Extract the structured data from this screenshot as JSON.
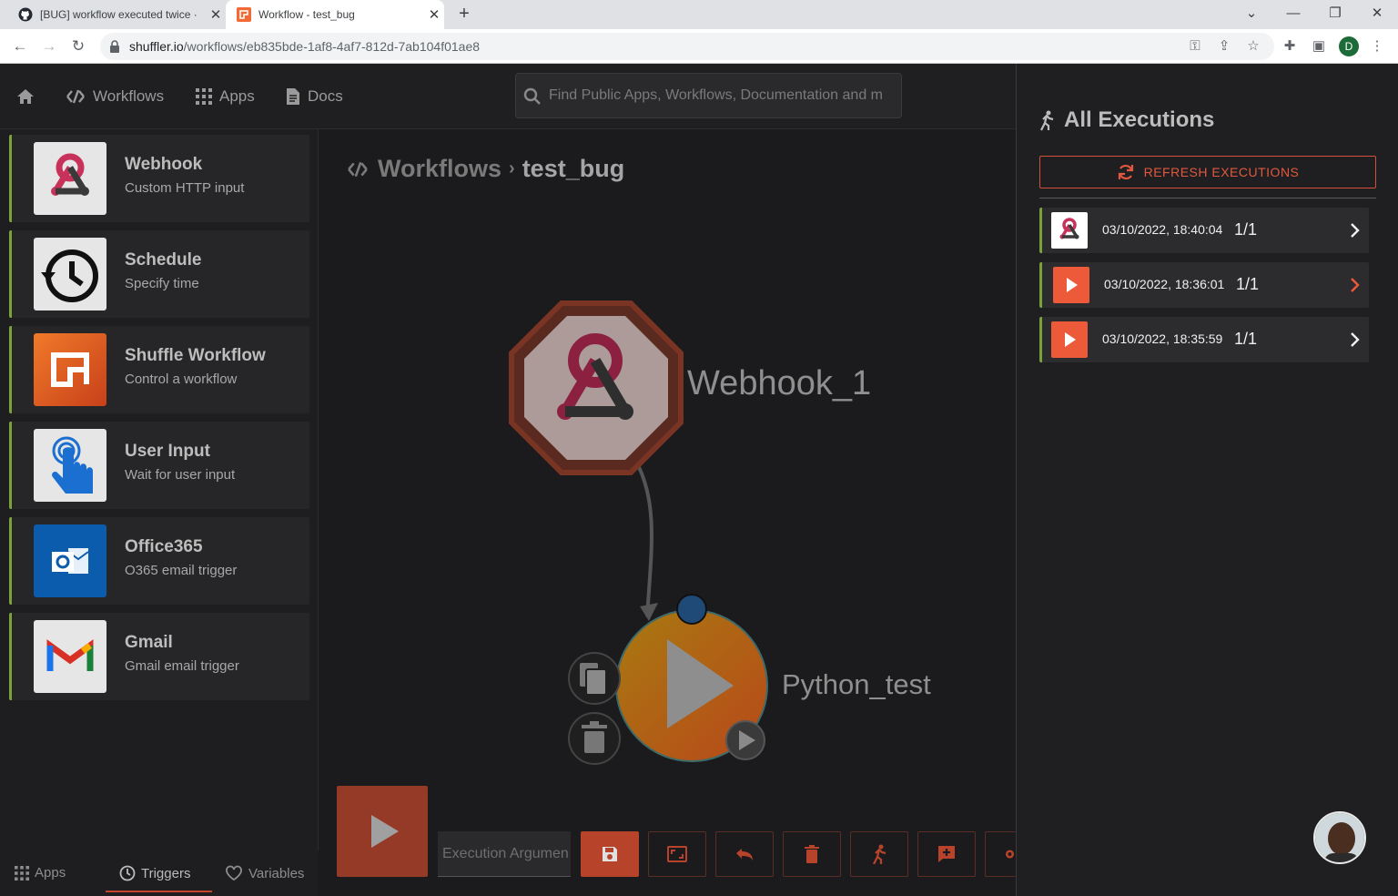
{
  "browser": {
    "tabs": [
      {
        "title": "[BUG] workflow executed twice ·",
        "close": "✕"
      },
      {
        "title": "Workflow - test_bug",
        "close": "✕"
      }
    ],
    "new_tab": "+",
    "url_host": "shuffler.io",
    "url_path": "/workflows/eb835bde-1af8-4af7-812d-7ab104f01ae8",
    "profile_initial": "D"
  },
  "nav": {
    "workflows": "Workflows",
    "apps": "Apps",
    "docs": "Docs",
    "search_placeholder": "Find Public Apps, Workflows, Documentation and m"
  },
  "sidebar": {
    "triggers": [
      {
        "name": "Webhook",
        "desc": "Custom HTTP input",
        "icon": "webhook-icon"
      },
      {
        "name": "Schedule",
        "desc": "Specify time",
        "icon": "clock-history-icon"
      },
      {
        "name": "Shuffle Workflow",
        "desc": "Control a workflow",
        "icon": "shuffle-icon"
      },
      {
        "name": "User Input",
        "desc": "Wait for user input",
        "icon": "touch-hand-icon"
      },
      {
        "name": "Office365",
        "desc": "O365 email trigger",
        "icon": "outlook-icon"
      },
      {
        "name": "Gmail",
        "desc": "Gmail email trigger",
        "icon": "gmail-icon"
      }
    ],
    "bottom_tabs": {
      "apps": "Apps",
      "triggers": "Triggers",
      "variables": "Variables"
    }
  },
  "canvas": {
    "breadcrumb_root": "Workflows",
    "breadcrumb_sep": "›",
    "workflow_name": "test_bug",
    "nodes": {
      "webhook": "Webhook_1",
      "python": "Python_test"
    },
    "exec_arg_placeholder": "Execution Argumen"
  },
  "executions": {
    "title": "All Executions",
    "refresh_label": "REFRESH EXECUTIONS",
    "rows": [
      {
        "time": "03/10/2022, 18:40:04",
        "count": "1/1",
        "icon": "webhook-icon"
      },
      {
        "time": "03/10/2022, 18:36:01",
        "count": "1/1",
        "icon": "play-icon"
      },
      {
        "time": "03/10/2022, 18:35:59",
        "count": "1/1",
        "icon": "play-icon"
      }
    ]
  },
  "colors": {
    "accent": "#d84b2e",
    "status_ok": "#7aa23c",
    "panel_bg": "#1f1f21"
  }
}
